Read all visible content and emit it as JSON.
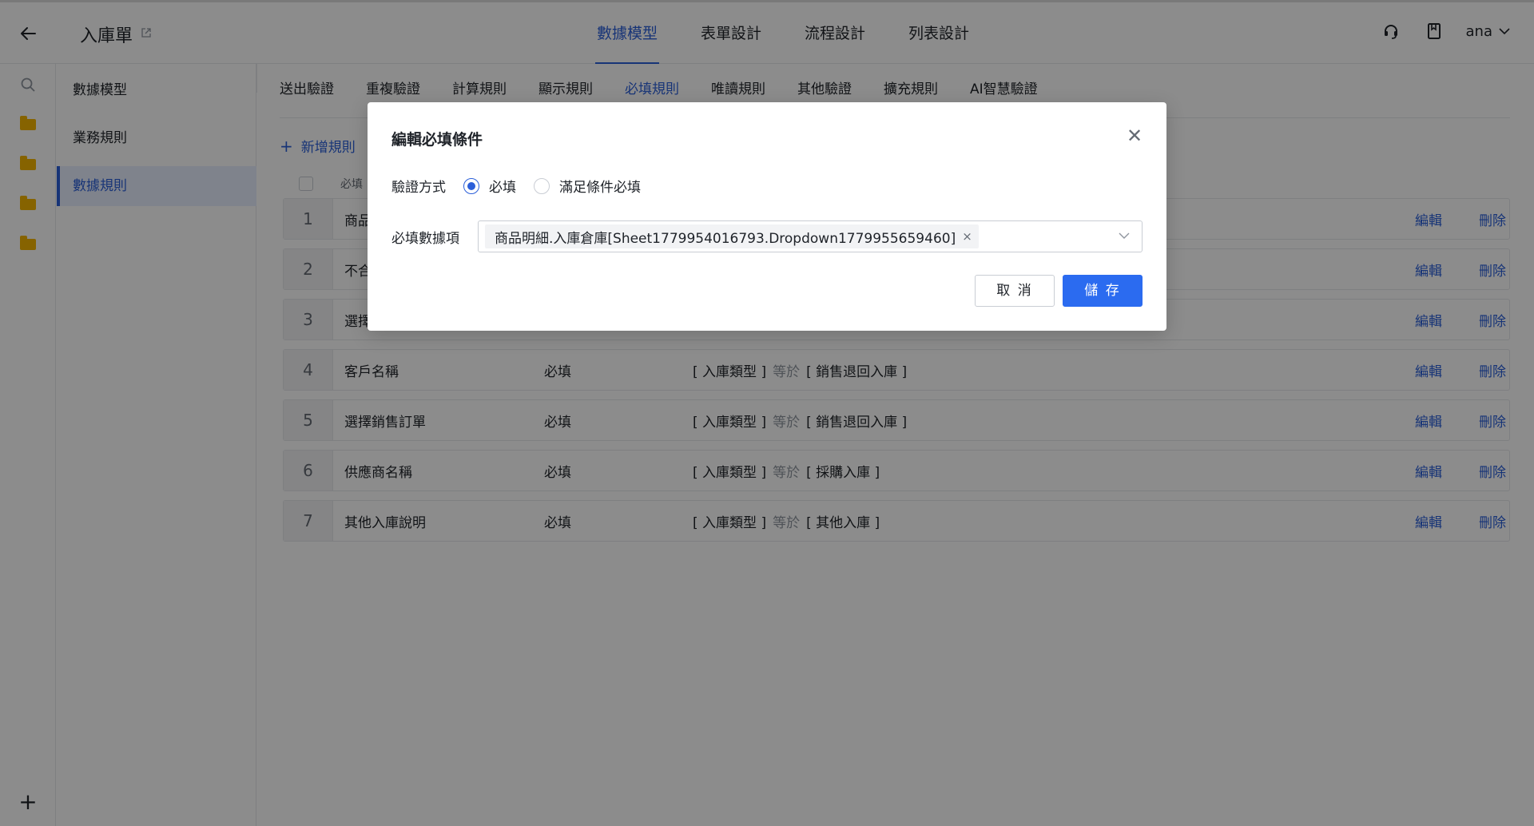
{
  "header": {
    "title": "入庫單",
    "tabs": [
      "數據模型",
      "表單設計",
      "流程設計",
      "列表設計"
    ],
    "user": "ana"
  },
  "sidebar": {
    "items": [
      "數據模型",
      "業務規則",
      "數據規則"
    ]
  },
  "main": {
    "sub_tabs": [
      "送出驗證",
      "重複驗證",
      "計算規則",
      "顯示規則",
      "必填規則",
      "唯讀規則",
      "其他驗證",
      "擴充規則",
      "AI智慧驗證"
    ],
    "add_rule_label": "新增規則",
    "column_header_partial": "必填",
    "rows": [
      {
        "index": "1",
        "name": "商品",
        "required": "",
        "cond_field": "",
        "cond_op": "",
        "cond_value": "",
        "edit": "編輯",
        "delete": "刪除"
      },
      {
        "index": "2",
        "name": "不合",
        "required": "",
        "cond_field": "",
        "cond_op": "",
        "cond_value": "",
        "edit": "編輯",
        "delete": "刪除"
      },
      {
        "index": "3",
        "name": "選擇",
        "required": "",
        "cond_field": "",
        "cond_op": "",
        "cond_value": "",
        "edit": "編輯",
        "delete": "刪除"
      },
      {
        "index": "4",
        "name": "客戶名稱",
        "required": "必填",
        "cond_field": "[ 入庫類型 ]",
        "cond_op": "等於",
        "cond_value": "[ 銷售退回入庫 ]",
        "edit": "編輯",
        "delete": "刪除"
      },
      {
        "index": "5",
        "name": "選擇銷售訂單",
        "required": "必填",
        "cond_field": "[ 入庫類型 ]",
        "cond_op": "等於",
        "cond_value": "[ 銷售退回入庫 ]",
        "edit": "編輯",
        "delete": "刪除"
      },
      {
        "index": "6",
        "name": "供應商名稱",
        "required": "必填",
        "cond_field": "[ 入庫類型 ]",
        "cond_op": "等於",
        "cond_value": "[ 採購入庫 ]",
        "edit": "編輯",
        "delete": "刪除"
      },
      {
        "index": "7",
        "name": "其他入庫說明",
        "required": "必填",
        "cond_field": "[ 入庫類型 ]",
        "cond_op": "等於",
        "cond_value": "[ 其他入庫 ]",
        "edit": "編輯",
        "delete": "刪除"
      }
    ]
  },
  "modal": {
    "title": "編輯必填條件",
    "method_label": "驗證方式",
    "option_required": "必填",
    "option_conditional": "滿足條件必填",
    "field_label": "必填數據項",
    "selected_tag": "商品明細.入庫倉庫[Sheet1779954016793.Dropdown1779955659460]",
    "cancel_label": "取 消",
    "save_label": "儲 存"
  },
  "colors": {
    "accent": "#2b5fd9",
    "primary_button": "#2b6bf0",
    "folder": "#f5b400"
  }
}
